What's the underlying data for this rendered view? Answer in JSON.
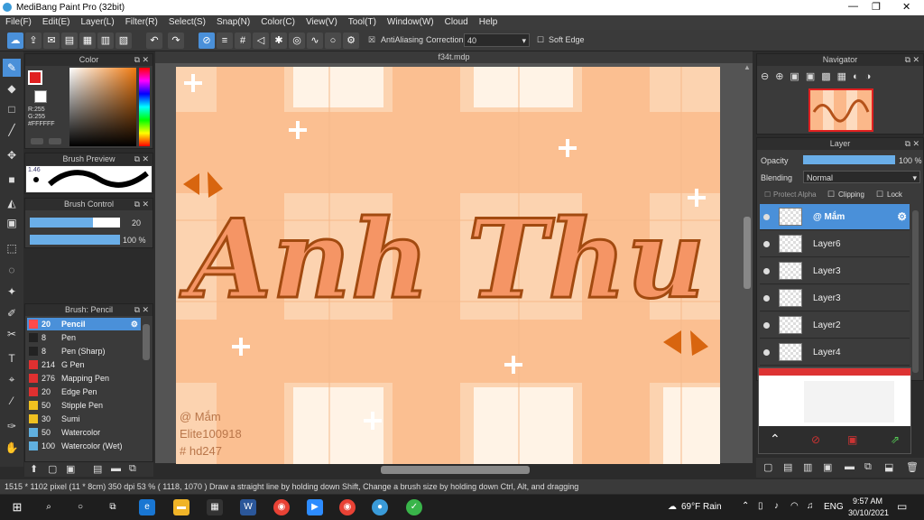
{
  "app": {
    "title": "MediBang Paint Pro (32bit)"
  },
  "menu": [
    "File(F)",
    "Edit(E)",
    "Layer(L)",
    "Filter(R)",
    "Select(S)",
    "Snap(N)",
    "Color(C)",
    "View(V)",
    "Tool(T)",
    "Window(W)",
    "Cloud",
    "Help"
  ],
  "toolbar": {
    "antialias_label": "AntiAliasing",
    "correction_label": "Correction",
    "correction_value": "40",
    "soft_edge_label": "Soft Edge"
  },
  "color_panel": {
    "title": "Color",
    "r": "R:255",
    "g": "G:255",
    "b": "B:255",
    "hex": "#FFFFFF"
  },
  "brush_preview": {
    "title": "Brush Preview",
    "size": "1.46"
  },
  "brush_control": {
    "title": "Brush Control",
    "size": "20",
    "opacity": "100 %",
    "size_fill": 0.7,
    "opacity_fill": 1.0
  },
  "brush_list": {
    "title": "Brush: Pencil",
    "items": [
      {
        "size": "20",
        "name": "Pencil",
        "color": "#ff4a4a"
      },
      {
        "size": "8",
        "name": "Pen",
        "color": "#222222"
      },
      {
        "size": "8",
        "name": "Pen (Sharp)",
        "color": "#222222"
      },
      {
        "size": "214",
        "name": "G Pen",
        "color": "#e03030"
      },
      {
        "size": "276",
        "name": "Mapping Pen",
        "color": "#e03030"
      },
      {
        "size": "20",
        "name": "Edge Pen",
        "color": "#e03030"
      },
      {
        "size": "50",
        "name": "Stipple Pen",
        "color": "#f0c020"
      },
      {
        "size": "30",
        "name": "Sumi",
        "color": "#f0c020"
      },
      {
        "size": "50",
        "name": "Watercolor",
        "color": "#60b0e0"
      },
      {
        "size": "100",
        "name": "Watercolor (Wet)",
        "color": "#60b0e0"
      }
    ]
  },
  "document": {
    "tab": "f34t.mdp",
    "artwork_text": "Anh Thu",
    "watermark": [
      "@ Mắm",
      "Elite100918",
      "# hd247"
    ]
  },
  "navigator": {
    "title": "Navigator"
  },
  "layer_panel": {
    "title": "Layer",
    "opacity_label": "Opacity",
    "opacity_value": "100 %",
    "blending_label": "Blending",
    "blending_value": "Normal",
    "protect_alpha": "Protect Alpha",
    "clipping": "Clipping",
    "lock": "Lock",
    "layers": [
      "@ Mắm",
      "Layer6",
      "Layer3",
      "Layer3",
      "Layer2",
      "Layer4"
    ]
  },
  "status": {
    "text": "1515 * 1102 pixel  (11 * 8cm)  350 dpi  53 %  ( 1118, 1070 )  Draw a straight line by holding down Shift, Change a brush size by holding down Ctrl, Alt, and dragging"
  },
  "taskbar": {
    "weather": "69°F  Rain",
    "lang": "ENG",
    "time": "9:57 AM",
    "date": "30/10/2021"
  }
}
